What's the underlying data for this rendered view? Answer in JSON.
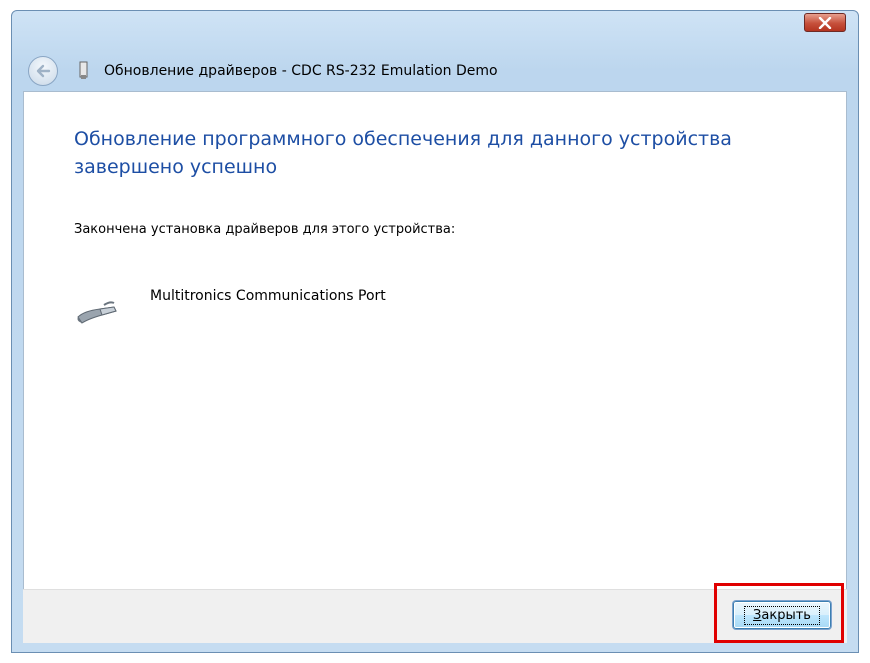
{
  "window": {
    "title": "Обновление драйверов - CDC RS-232 Emulation Demo",
    "close_glyph": "✕"
  },
  "content": {
    "heading": "Обновление программного обеспечения для данного устройства завершено успешно",
    "subtext": "Закончена установка драйверов для этого устройства:",
    "device_name": "Multitronics Communications Port"
  },
  "footer": {
    "close_button_accel": "З",
    "close_button_rest": "акрыть"
  },
  "colors": {
    "heading": "#1d4ea4",
    "highlight": "#e00000"
  }
}
